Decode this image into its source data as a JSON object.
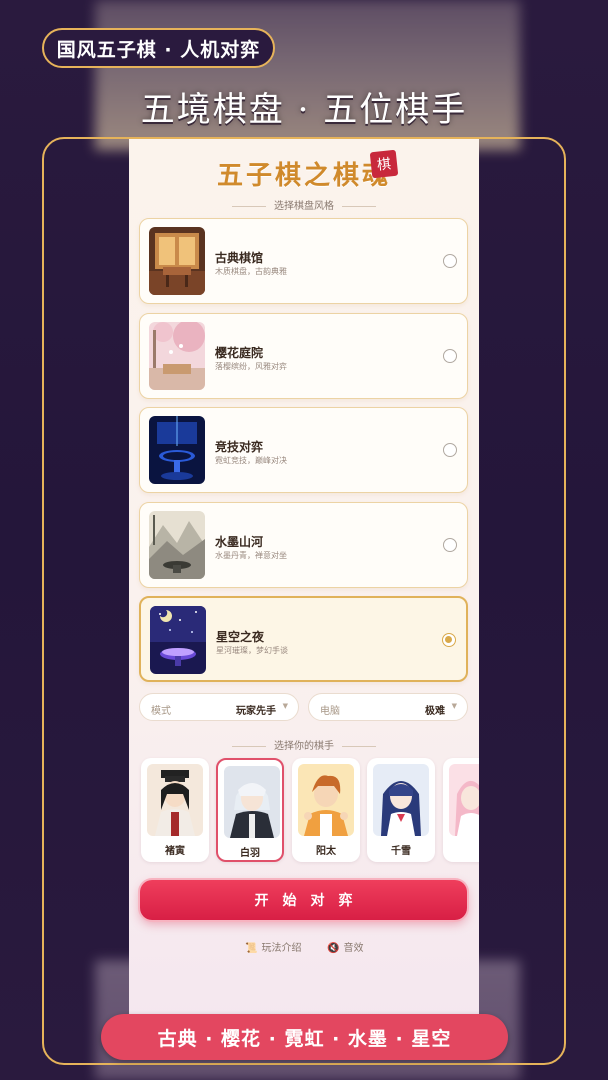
{
  "promo": {
    "badge": "国风五子棋 · 人机对弈",
    "headline": "五境棋盘 · 五位棋手",
    "bottom_tags": "古典 · 樱花 · 霓虹 · 水墨 · 星空"
  },
  "app": {
    "logo_text": "五子棋之棋魂",
    "logo_seal": "棋",
    "board_section_title": "选择棋盘风格",
    "boards": [
      {
        "title": "古典棋馆",
        "subtitle": "木质棋盘，古韵典雅",
        "selected": false
      },
      {
        "title": "樱花庭院",
        "subtitle": "落樱缤纷，风雅对弈",
        "selected": false
      },
      {
        "title": "竞技对弈",
        "subtitle": "霓虹竞技，巅峰对决",
        "selected": false
      },
      {
        "title": "水墨山河",
        "subtitle": "水墨丹青，禅意对坐",
        "selected": false
      },
      {
        "title": "星空之夜",
        "subtitle": "星河璀璨，梦幻手谈",
        "selected": true
      }
    ],
    "mode_select": {
      "label": "模式",
      "value": "玩家先手"
    },
    "ai_select": {
      "label": "电脑",
      "value": "极难"
    },
    "player_section_title": "选择你的棋手",
    "players": [
      {
        "name": "褚寅",
        "selected": false
      },
      {
        "name": "白羽",
        "selected": true
      },
      {
        "name": "阳太",
        "selected": false
      },
      {
        "name": "千雪",
        "selected": false
      },
      {
        "name": "",
        "selected": false
      }
    ],
    "start_button": "开始对弈",
    "rules_link": "玩法介绍",
    "sound_link": "音效",
    "rules_icon": "scroll-icon",
    "sound_icon": "mute-icon"
  },
  "colors": {
    "accent_gold": "#e6b35a",
    "accent_red": "#d81f45",
    "background": "#2a1a3e"
  }
}
